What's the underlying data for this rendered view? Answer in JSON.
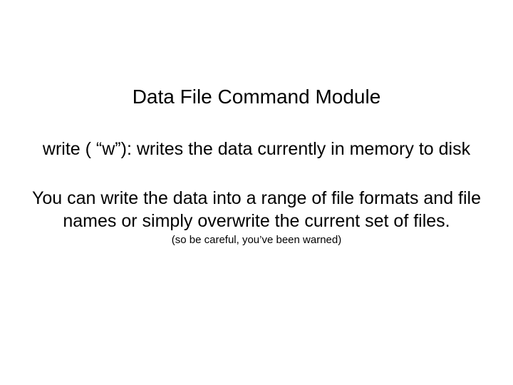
{
  "slide": {
    "title": "Data File Command Module",
    "paragraph1": "write ( “w”): writes the data currently in memory to disk",
    "paragraph2": "You can write the data into a range of file formats and file names or simply overwrite the current set of files.",
    "warning": "(so be careful, you’ve been warned)"
  }
}
